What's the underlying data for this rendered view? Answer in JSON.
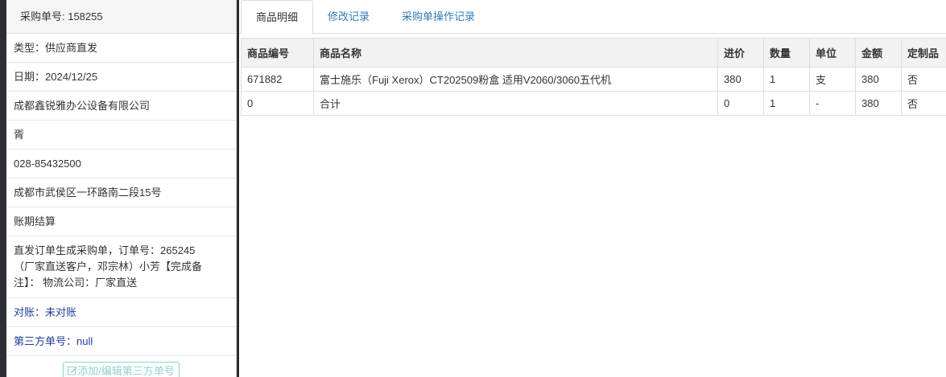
{
  "left": {
    "header": "采购单号: 158255",
    "type": "类型：供应商直发",
    "date": "日期：2024/12/25",
    "supplier": "成都鑫锐雅办公设备有限公司",
    "contact": "胥",
    "phone": "028-85432500",
    "address": "成都市武侯区一环路南二段15号",
    "payment": "账期结算",
    "remark_line1": "直发订单生成采购单，订单号：265245",
    "remark_line2": "（厂家直送客户，邓宗林）小芳【完成备",
    "remark_line3": "注】： 物流公司：厂家直送",
    "reconcile": "对账：未对账",
    "third_party": "第三方单号：null",
    "edit_button": "添加/编辑第三方单号"
  },
  "tabs": [
    "商品明细",
    "修改记录",
    "采购单操作记录"
  ],
  "table": {
    "headers": [
      "商品编号",
      "商品名称",
      "进价",
      "数量",
      "单位",
      "金额",
      "定制品"
    ],
    "rows": [
      [
        "671882",
        "富士施乐（Fuji Xerox）CT202509粉盒 适用V2060/3060五代机",
        "380",
        "1",
        "支",
        "380",
        "否"
      ],
      [
        "0",
        "合计",
        "0",
        "1",
        "-",
        "380",
        "否"
      ]
    ]
  }
}
